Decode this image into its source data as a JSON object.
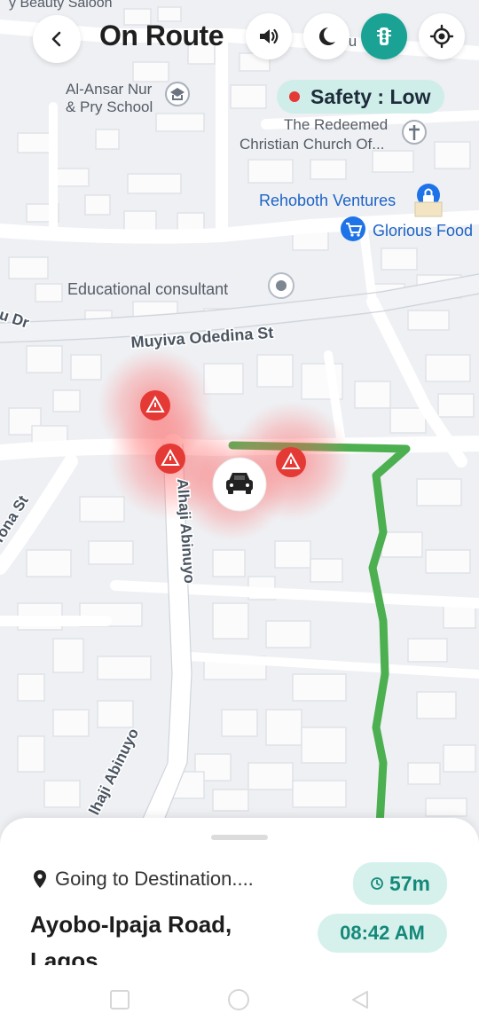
{
  "header": {
    "title": "On Route",
    "back_icon": "chevron-left-icon",
    "sound_icon": "speaker-icon",
    "theme_icon": "moon-icon",
    "traffic_icon": "traffic-light-icon",
    "locate_icon": "crosshair-icon"
  },
  "safety": {
    "label": "Safety : Low",
    "dot_color": "#e53935"
  },
  "map": {
    "top_label": "y Beauty Saloon",
    "partial_label": "lu",
    "school_line1": "Al-Ansar Nur",
    "school_line2": "& Pry School",
    "church_line1": "The Redeemed",
    "church_line2": "Christian Church Of...",
    "rehoboth": "Rehoboth Ventures",
    "glorious": "Glorious Food",
    "educational": "Educational consultant",
    "muyiva": "Muyiva Odedina St",
    "dr_label": "u Dr",
    "tona": "Tona St",
    "abinuyo1": "Alhaji Abinuyo",
    "abinuyo2": "lhaji Abinuyo",
    "route_color": "#4caf50",
    "hazard_color": "#e53935",
    "car_icon": "car-icon",
    "hazard_icon": "warning-triangle-icon"
  },
  "sheet": {
    "going_label": "Going to Destination....",
    "destination_line1": "Ayobo-Ipaja Road,",
    "destination_line2": "Lagos",
    "duration": "57m",
    "arrival": "08:42 AM",
    "accent": "#14897a"
  },
  "navbar": {
    "recents_icon": "square-icon",
    "home_icon": "circle-icon",
    "back_icon": "triangle-back-icon"
  }
}
